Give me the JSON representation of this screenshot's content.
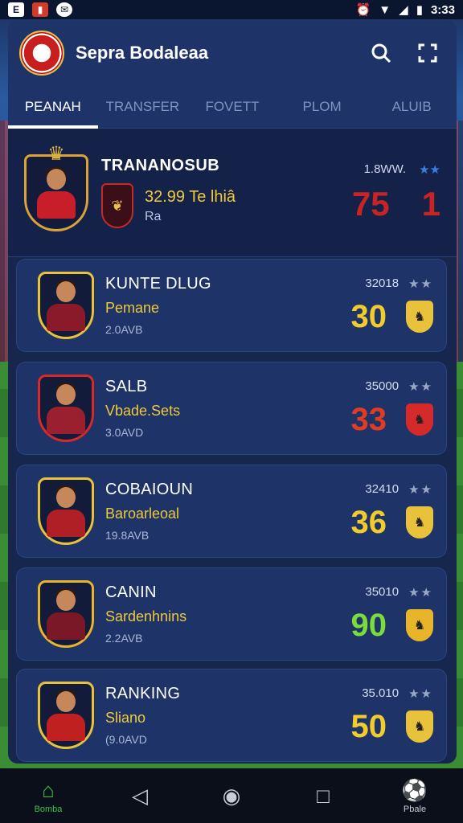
{
  "status": {
    "left_icons": [
      "app-icon-e",
      "notification-flag-icon",
      "messenger-icon"
    ],
    "time": "3:33"
  },
  "app": {
    "title": "Sepra Bodaleaa",
    "tabs": [
      {
        "label": "PEANAH"
      },
      {
        "label": "TRANSFER"
      },
      {
        "label": "FOVETT"
      },
      {
        "label": "PLOM"
      },
      {
        "label": "ALUIB"
      }
    ]
  },
  "hero": {
    "name": "TRANANOSUB",
    "value": "32.99 Te lhiâ",
    "sub": "Ra",
    "rating_label": "1.8WW.",
    "stars": "★★",
    "big_left": "75",
    "big_right": "1"
  },
  "cards": [
    {
      "name": "KUNTE DLUG",
      "position": "Pemane",
      "sub": "2.0AVB",
      "price": "32018",
      "stars": "★★",
      "score": "30",
      "score_color": "#f2cc2a",
      "badge_color": "#e7c23a",
      "shirt_color": "#8a1a2a"
    },
    {
      "name": "SALB",
      "position": "Vbade.Sets",
      "sub": "3.0AVD",
      "price": "35000",
      "stars": "★★",
      "score": "33",
      "score_color": "#e33a22",
      "badge_color": "#d62a2a",
      "shirt_color": "#9a2030"
    },
    {
      "name": "COBAIOUN",
      "position": "Baroarleoal",
      "sub": "19.8AVB",
      "price": "32410",
      "stars": "★★",
      "score": "36",
      "score_color": "#f2cc2a",
      "badge_color": "#e7c23a",
      "shirt_color": "#b01f25"
    },
    {
      "name": "CANIN",
      "position": "Sardenhnins",
      "sub": "2.2AVB",
      "price": "35010",
      "stars": "★★",
      "score": "90",
      "score_color": "#7bdc3a",
      "badge_color": "#e7b42a",
      "shirt_color": "#7a1828"
    },
    {
      "name": "RANKING",
      "position": "Sliano",
      "sub": "(9.0AVD",
      "price": "35.010",
      "stars": "★★",
      "score": "50",
      "score_color": "#f2cc2a",
      "badge_color": "#e7c23a",
      "shirt_color": "#c02020"
    }
  ],
  "nav": [
    {
      "label": "Bomba",
      "icon": "home-icon"
    },
    {
      "label": "",
      "icon": "back-icon"
    },
    {
      "label": "",
      "icon": "home-circle-icon"
    },
    {
      "label": "",
      "icon": "recent-apps-icon"
    },
    {
      "label": "Pbale",
      "icon": "ball-icon"
    }
  ]
}
